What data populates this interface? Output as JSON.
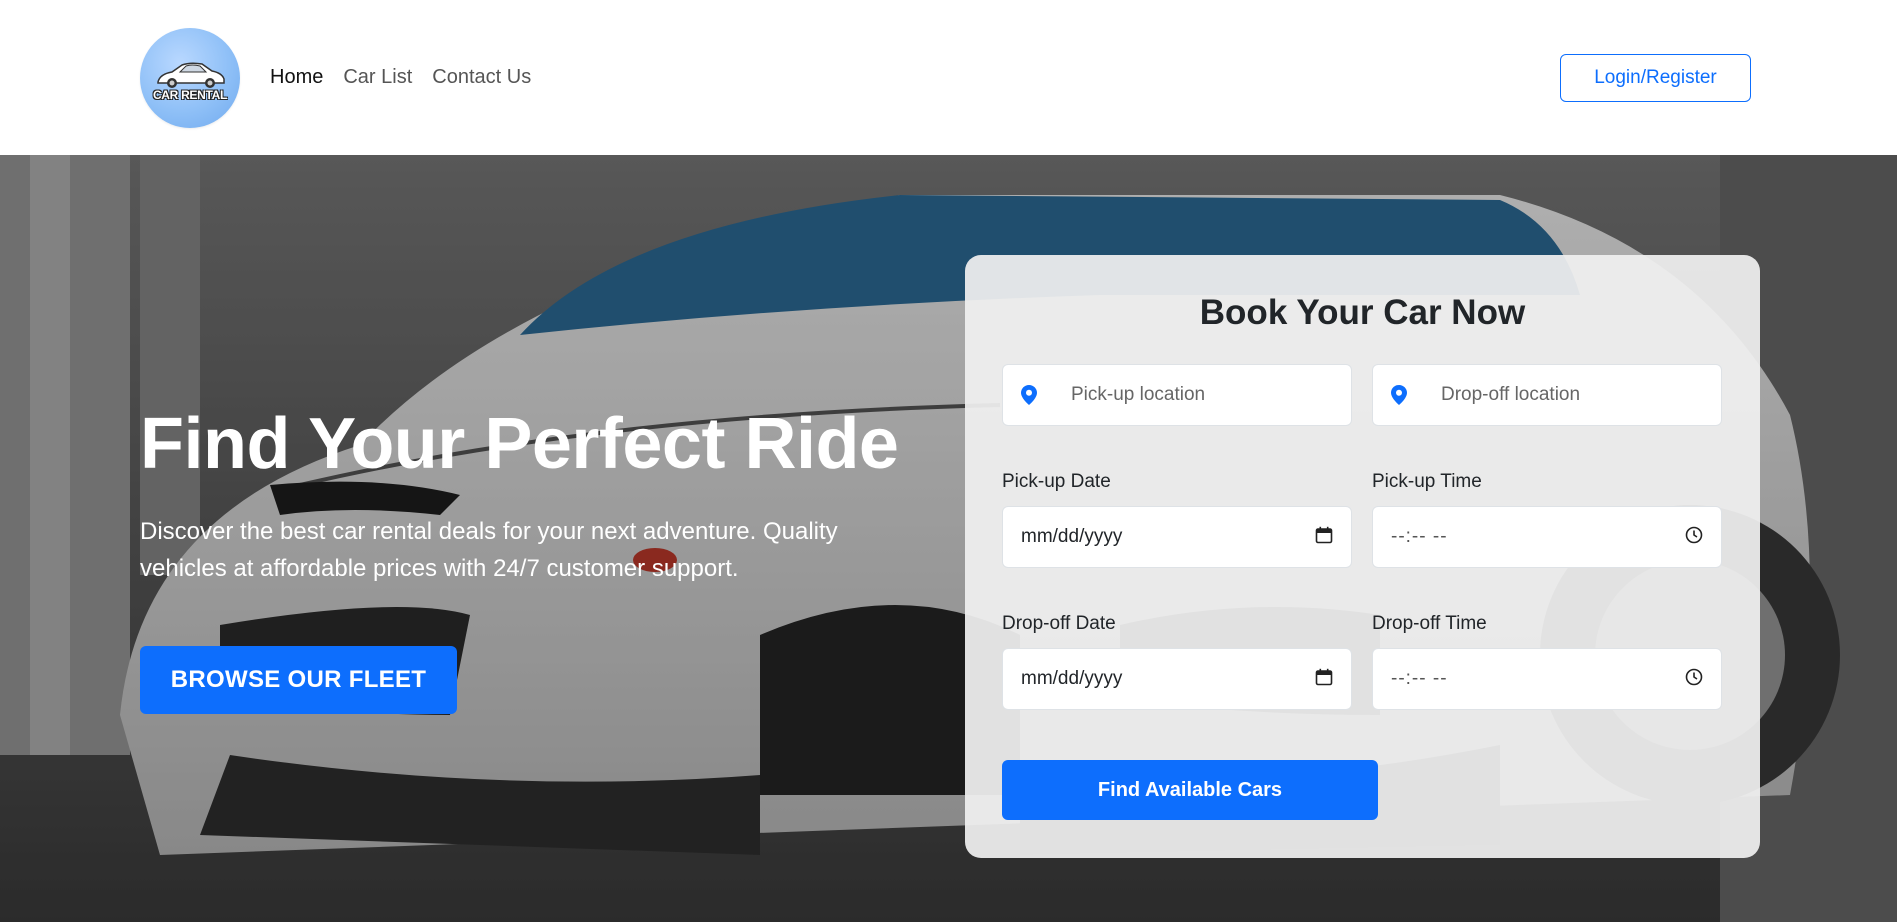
{
  "brand": {
    "logo_text": "CAR RENTAL"
  },
  "nav": {
    "items": [
      {
        "label": "Home",
        "active": true
      },
      {
        "label": "Car List",
        "active": false
      },
      {
        "label": "Contact Us",
        "active": false
      }
    ],
    "login_label": "Login/Register"
  },
  "hero": {
    "title": "Find Your Perfect Ride",
    "subtitle": "Discover the best car rental deals for your next adventure. Quality vehicles at affordable prices with 24/7 customer support.",
    "cta_label": "BROWSE OUR FLEET"
  },
  "booking": {
    "title": "Book Your Car Now",
    "pickup_location_placeholder": "Pick-up location",
    "dropoff_location_placeholder": "Drop-off location",
    "pickup_date_label": "Pick-up Date",
    "pickup_date_value": "mm/dd/yyyy",
    "pickup_time_label": "Pick-up Time",
    "pickup_time_value": "--:-- --",
    "dropoff_date_label": "Drop-off Date",
    "dropoff_date_value": "mm/dd/yyyy",
    "dropoff_time_label": "Drop-off Time",
    "dropoff_time_value": "--:-- --",
    "submit_label": "Find Available Cars"
  },
  "colors": {
    "primary": "#0d6efd",
    "logo_bg": "#8fc0f7"
  },
  "icons": [
    "car-logo-icon",
    "map-pin-icon",
    "calendar-icon",
    "clock-icon"
  ]
}
